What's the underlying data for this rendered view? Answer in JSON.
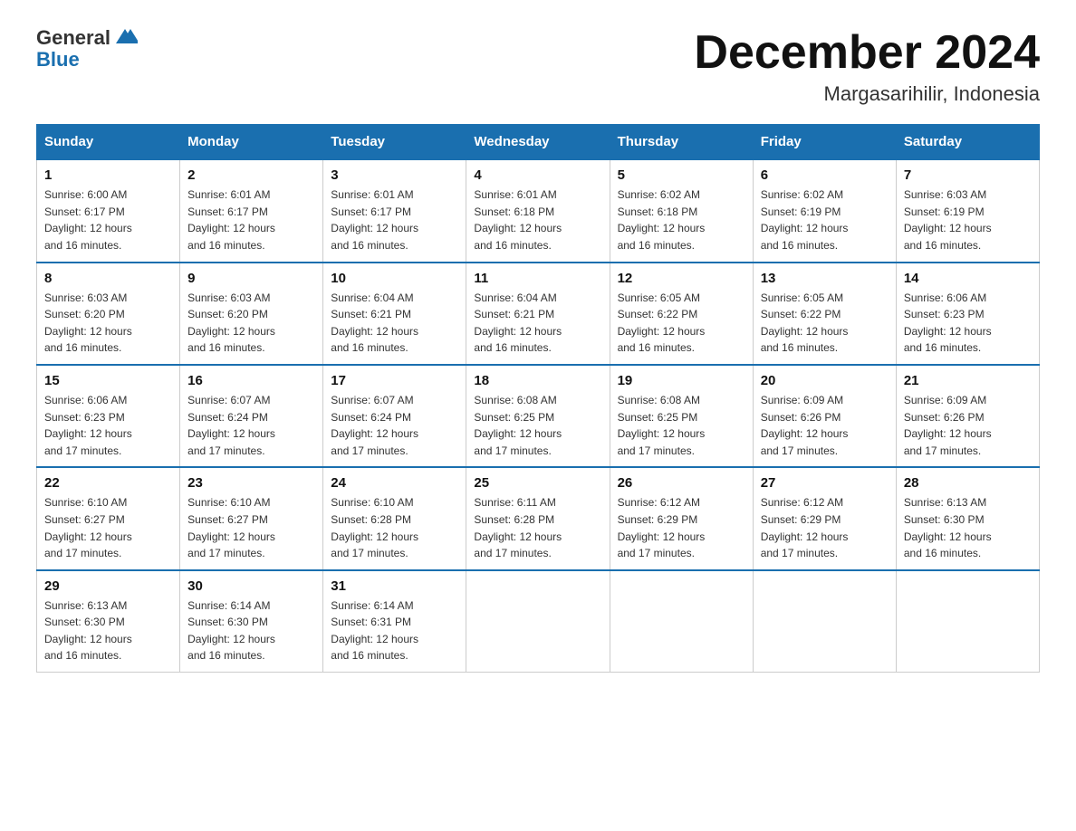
{
  "header": {
    "logo_general": "General",
    "logo_blue": "Blue",
    "month_title": "December 2024",
    "location": "Margasarihilir, Indonesia"
  },
  "weekdays": [
    "Sunday",
    "Monday",
    "Tuesday",
    "Wednesday",
    "Thursday",
    "Friday",
    "Saturday"
  ],
  "weeks": [
    [
      {
        "day": "1",
        "sunrise": "6:00 AM",
        "sunset": "6:17 PM",
        "daylight": "12 hours and 16 minutes."
      },
      {
        "day": "2",
        "sunrise": "6:01 AM",
        "sunset": "6:17 PM",
        "daylight": "12 hours and 16 minutes."
      },
      {
        "day": "3",
        "sunrise": "6:01 AM",
        "sunset": "6:17 PM",
        "daylight": "12 hours and 16 minutes."
      },
      {
        "day": "4",
        "sunrise": "6:01 AM",
        "sunset": "6:18 PM",
        "daylight": "12 hours and 16 minutes."
      },
      {
        "day": "5",
        "sunrise": "6:02 AM",
        "sunset": "6:18 PM",
        "daylight": "12 hours and 16 minutes."
      },
      {
        "day": "6",
        "sunrise": "6:02 AM",
        "sunset": "6:19 PM",
        "daylight": "12 hours and 16 minutes."
      },
      {
        "day": "7",
        "sunrise": "6:03 AM",
        "sunset": "6:19 PM",
        "daylight": "12 hours and 16 minutes."
      }
    ],
    [
      {
        "day": "8",
        "sunrise": "6:03 AM",
        "sunset": "6:20 PM",
        "daylight": "12 hours and 16 minutes."
      },
      {
        "day": "9",
        "sunrise": "6:03 AM",
        "sunset": "6:20 PM",
        "daylight": "12 hours and 16 minutes."
      },
      {
        "day": "10",
        "sunrise": "6:04 AM",
        "sunset": "6:21 PM",
        "daylight": "12 hours and 16 minutes."
      },
      {
        "day": "11",
        "sunrise": "6:04 AM",
        "sunset": "6:21 PM",
        "daylight": "12 hours and 16 minutes."
      },
      {
        "day": "12",
        "sunrise": "6:05 AM",
        "sunset": "6:22 PM",
        "daylight": "12 hours and 16 minutes."
      },
      {
        "day": "13",
        "sunrise": "6:05 AM",
        "sunset": "6:22 PM",
        "daylight": "12 hours and 16 minutes."
      },
      {
        "day": "14",
        "sunrise": "6:06 AM",
        "sunset": "6:23 PM",
        "daylight": "12 hours and 16 minutes."
      }
    ],
    [
      {
        "day": "15",
        "sunrise": "6:06 AM",
        "sunset": "6:23 PM",
        "daylight": "12 hours and 17 minutes."
      },
      {
        "day": "16",
        "sunrise": "6:07 AM",
        "sunset": "6:24 PM",
        "daylight": "12 hours and 17 minutes."
      },
      {
        "day": "17",
        "sunrise": "6:07 AM",
        "sunset": "6:24 PM",
        "daylight": "12 hours and 17 minutes."
      },
      {
        "day": "18",
        "sunrise": "6:08 AM",
        "sunset": "6:25 PM",
        "daylight": "12 hours and 17 minutes."
      },
      {
        "day": "19",
        "sunrise": "6:08 AM",
        "sunset": "6:25 PM",
        "daylight": "12 hours and 17 minutes."
      },
      {
        "day": "20",
        "sunrise": "6:09 AM",
        "sunset": "6:26 PM",
        "daylight": "12 hours and 17 minutes."
      },
      {
        "day": "21",
        "sunrise": "6:09 AM",
        "sunset": "6:26 PM",
        "daylight": "12 hours and 17 minutes."
      }
    ],
    [
      {
        "day": "22",
        "sunrise": "6:10 AM",
        "sunset": "6:27 PM",
        "daylight": "12 hours and 17 minutes."
      },
      {
        "day": "23",
        "sunrise": "6:10 AM",
        "sunset": "6:27 PM",
        "daylight": "12 hours and 17 minutes."
      },
      {
        "day": "24",
        "sunrise": "6:10 AM",
        "sunset": "6:28 PM",
        "daylight": "12 hours and 17 minutes."
      },
      {
        "day": "25",
        "sunrise": "6:11 AM",
        "sunset": "6:28 PM",
        "daylight": "12 hours and 17 minutes."
      },
      {
        "day": "26",
        "sunrise": "6:12 AM",
        "sunset": "6:29 PM",
        "daylight": "12 hours and 17 minutes."
      },
      {
        "day": "27",
        "sunrise": "6:12 AM",
        "sunset": "6:29 PM",
        "daylight": "12 hours and 17 minutes."
      },
      {
        "day": "28",
        "sunrise": "6:13 AM",
        "sunset": "6:30 PM",
        "daylight": "12 hours and 16 minutes."
      }
    ],
    [
      {
        "day": "29",
        "sunrise": "6:13 AM",
        "sunset": "6:30 PM",
        "daylight": "12 hours and 16 minutes."
      },
      {
        "day": "30",
        "sunrise": "6:14 AM",
        "sunset": "6:30 PM",
        "daylight": "12 hours and 16 minutes."
      },
      {
        "day": "31",
        "sunrise": "6:14 AM",
        "sunset": "6:31 PM",
        "daylight": "12 hours and 16 minutes."
      },
      {
        "day": "",
        "sunrise": "",
        "sunset": "",
        "daylight": ""
      },
      {
        "day": "",
        "sunrise": "",
        "sunset": "",
        "daylight": ""
      },
      {
        "day": "",
        "sunrise": "",
        "sunset": "",
        "daylight": ""
      },
      {
        "day": "",
        "sunrise": "",
        "sunset": "",
        "daylight": ""
      }
    ]
  ],
  "labels": {
    "sunrise_prefix": "Sunrise: ",
    "sunset_prefix": "Sunset: ",
    "daylight_prefix": "Daylight: "
  }
}
